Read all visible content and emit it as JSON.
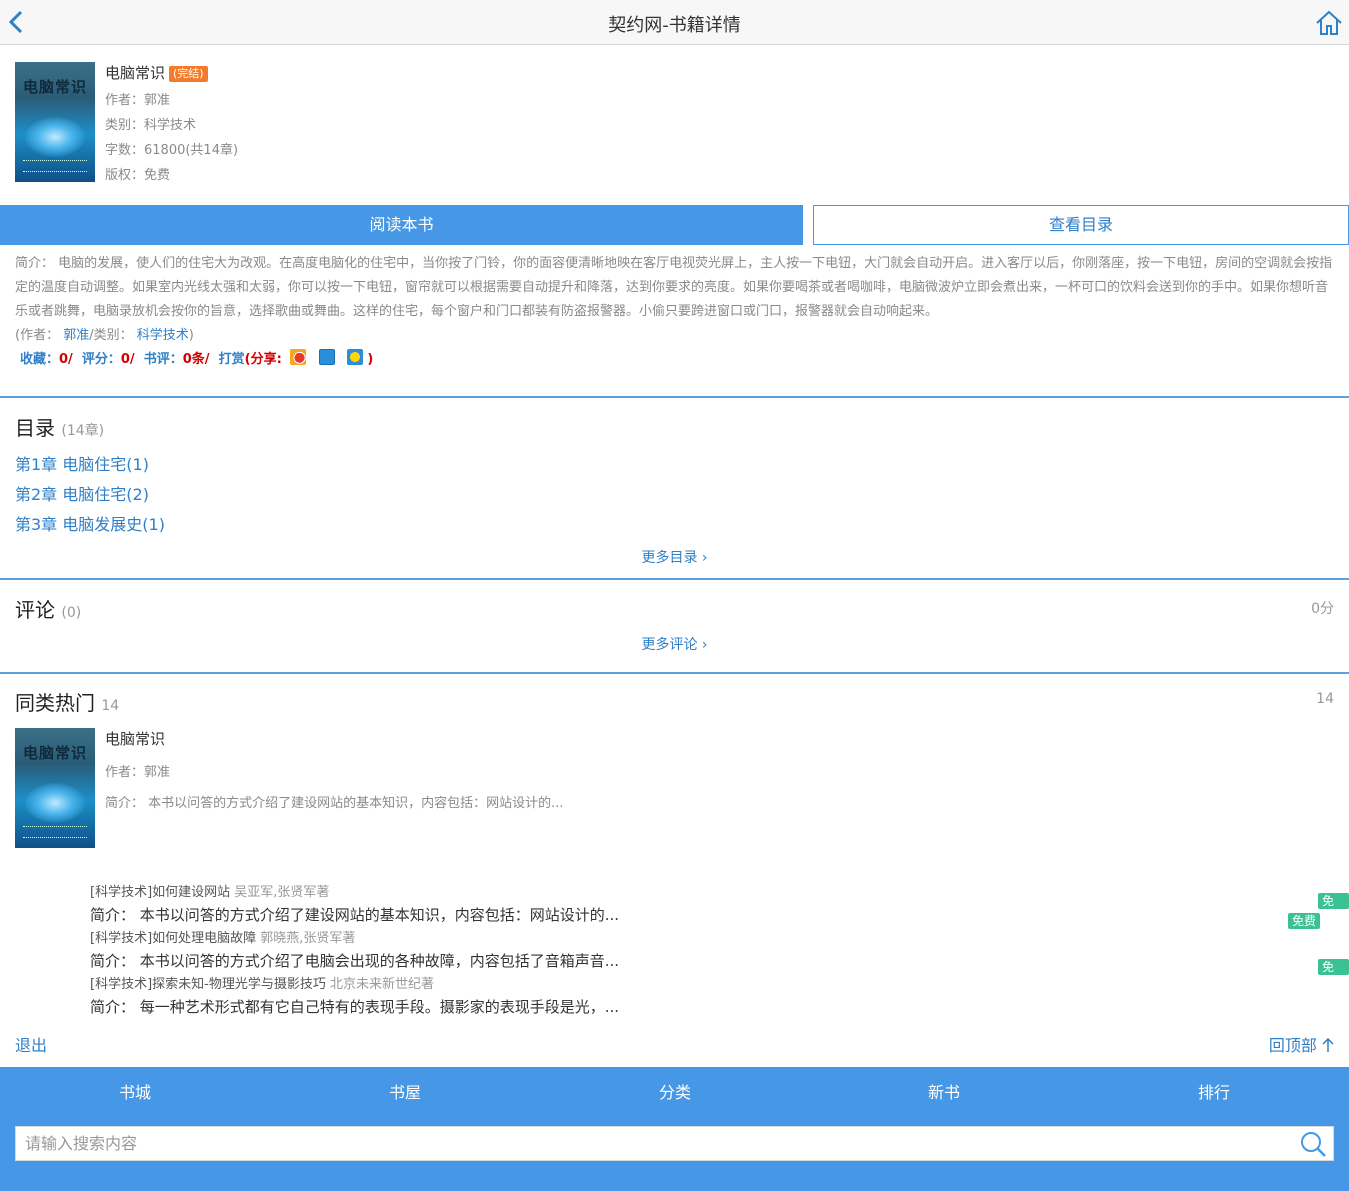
{
  "header": {
    "title": "契约网-书籍详情"
  },
  "book": {
    "cover_text": "电脑常识",
    "name": "电脑常识",
    "status_badge": "(完结)",
    "author": "作者：郭准",
    "category": "类别：科学技术",
    "words": "字数：61800(共14章)",
    "copyright": "版权：免费"
  },
  "actions": {
    "read_label": "阅读本书",
    "toc_label": "查看目录"
  },
  "intro": {
    "text": "简介： 电脑的发展，使人们的住宅大为改观。在高度电脑化的住宅中，当你按了门铃，你的面容便清晰地映在客厅电视荧光屏上，主人按一下电钮，大门就会自动开启。进入客厅以后，你刚落座，按一下电钮，房间的空调就会按指定的温度自动调整。如果室内光线太强和太弱，你可以按一下电钮，窗帘就可以根据需要自动提升和降落，达到你要求的亮度。如果你要喝茶或者喝咖啡，电脑微波炉立即会煮出来，一杯可口的饮料会送到你的手中。如果你想听音乐或者跳舞，电脑录放机会按你的旨意，选择歌曲或舞曲。这样的住宅，每个窗户和门口都装有防盗报警器。小偷只要跨进窗口或门口，报警器就会自动响起来。",
    "byline_prefix": "(作者：",
    "byline_author": "郭准",
    "byline_mid": "/类别：",
    "byline_category": "科学技术",
    "byline_suffix": ")"
  },
  "stats": {
    "fav_label": "收藏：",
    "fav_value": "0/",
    "score_label": "评分：",
    "score_value": "0/",
    "review_label": "书评：",
    "review_value": "0条/",
    "reward_label": "打赏",
    "share_label": "(分享:",
    "share_end": ")"
  },
  "toc": {
    "title": "目录",
    "count": "(14章)",
    "items": [
      "第1章 电脑住宅(1)",
      "第2章 电脑住宅(2)",
      "第3章 电脑发展史(1)"
    ],
    "more": "更多目录"
  },
  "comments": {
    "title": "评论",
    "count": "(0)",
    "score": "0分",
    "more": "更多评论"
  },
  "similar": {
    "title": "同类热门",
    "count": "14",
    "right_count": "14",
    "book": {
      "cover_text": "电脑常识",
      "name": "电脑常识",
      "author": "作者：郭准",
      "intro": "简介： 本书以问答的方式介绍了建设网站的基本知识，内容包括：网站设计的..."
    },
    "list": [
      {
        "head": "[科学技术]如何建设网站",
        "author": "吴亚军,张贤军著",
        "desc": "简介： 本书以问答的方式介绍了建设网站的基本知识，内容包括：网站设计的...",
        "badge": "免费"
      },
      {
        "head": "[科学技术]如何处理电脑故障",
        "author": "郭晓燕,张贤军著",
        "desc": "简介： 本书以问答的方式介绍了电脑会出现的各种故障，内容包括了音箱声音...",
        "badge": "免费"
      },
      {
        "head": "[科学技术]探索未知-物理光学与摄影技巧",
        "author": "北京未来新世纪著",
        "desc": "简介： 每一种艺术形式都有它自己特有的表现手段。摄影家的表现手段是光，...",
        "badge": "免费"
      }
    ]
  },
  "bottom": {
    "exit": "退出",
    "to_top": "回顶部"
  },
  "footer": {
    "nav": [
      "书城",
      "书屋",
      "分类",
      "新书",
      "排行"
    ],
    "search_placeholder": "请输入搜索内容"
  },
  "colors": {
    "accent": "#4698e6",
    "link": "#2f7fc9",
    "done_badge": "#f47b2a",
    "free_badge": "#3cc195",
    "stat_value": "#d40000"
  },
  "icons": {
    "back": "chevron-left-icon",
    "home": "home-icon",
    "search": "search-icon",
    "share": [
      "weibo-icon",
      "qzone-icon",
      "star-icon"
    ]
  }
}
